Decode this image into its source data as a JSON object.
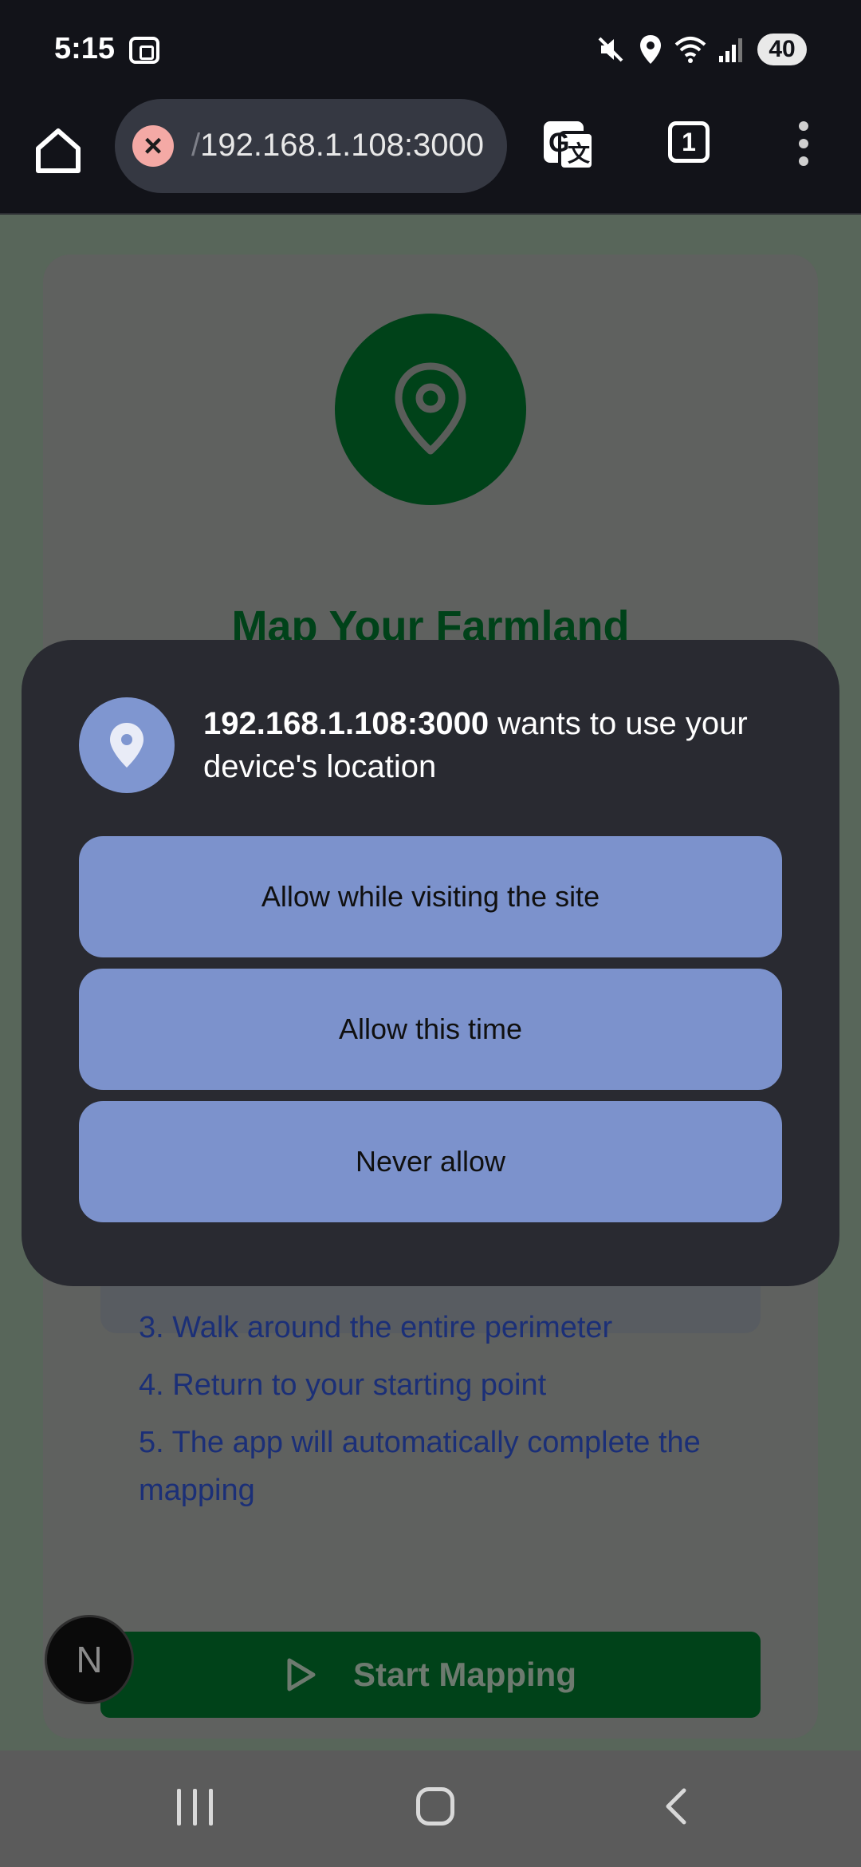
{
  "status_bar": {
    "time": "5:15",
    "battery": "40",
    "icons": [
      "screenshot-icon",
      "mute-icon",
      "location-icon",
      "wifi-icon",
      "signal-icon",
      "battery-icon"
    ]
  },
  "browser": {
    "url_prefix": "/",
    "url": "192.168.1.108:3000",
    "tab_count": "1",
    "icons": [
      "home-icon",
      "insecure-icon",
      "translate-icon",
      "tabs-icon",
      "menu-icon"
    ]
  },
  "page": {
    "title": "Map Your Farmland",
    "steps": [
      "3. Walk around the entire perimeter",
      "4. Return to your starting point",
      "5. The app will automatically complete the mapping"
    ],
    "start_button": "Start Mapping",
    "badge": "N",
    "colors": {
      "brand_green": "#004219",
      "step_text": "#1b2f77"
    }
  },
  "dialog": {
    "host": "192.168.1.108:3000",
    "message": " wants to use your device's location",
    "buttons": {
      "allow_site": "Allow while visiting the site",
      "allow_once": "Allow this time",
      "never": "Never allow"
    },
    "colors": {
      "background": "#292a31",
      "button": "#7c92cc"
    }
  }
}
